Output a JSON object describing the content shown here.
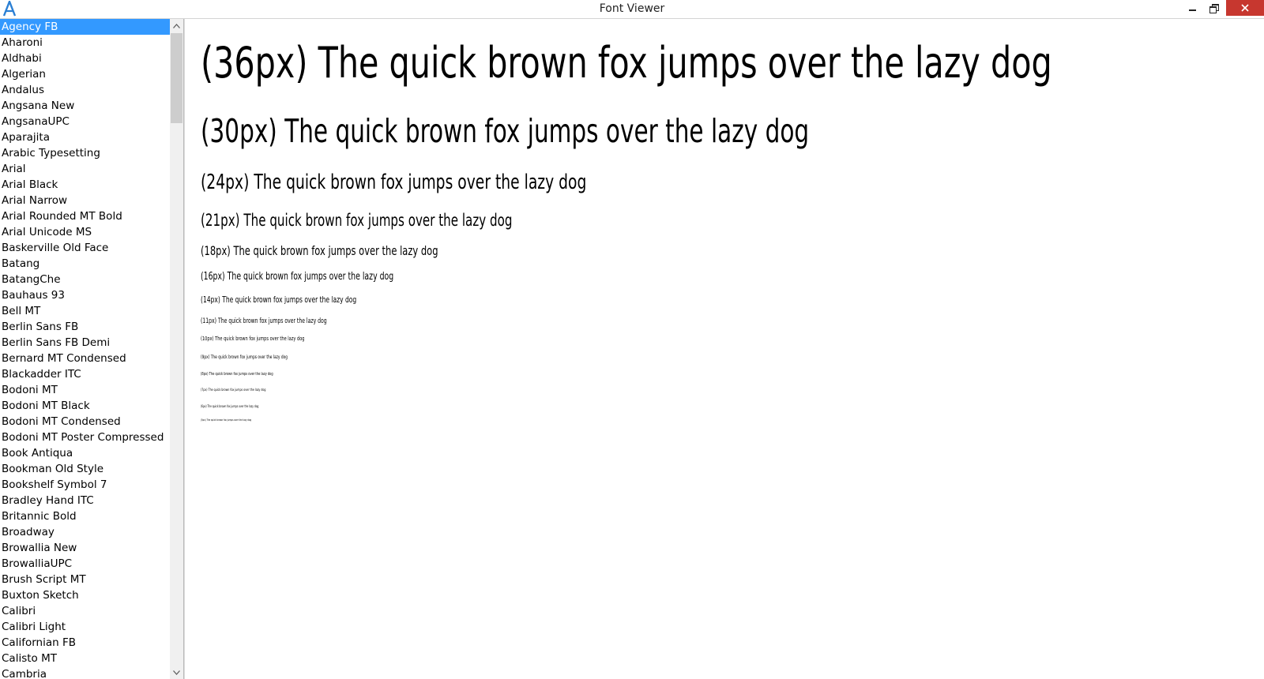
{
  "window": {
    "title": "Font Viewer",
    "logo_icon": "app-letter-a-icon"
  },
  "titlebar": {
    "minimize_icon": "minimize-icon",
    "restore_icon": "restore-icon",
    "close_icon": "close-icon",
    "close_color": "#c7372f"
  },
  "sidebar": {
    "selected_index": 0,
    "selected_color": "#3399ff",
    "fonts": [
      "Agency FB",
      "Aharoni",
      "Aldhabi",
      "Algerian",
      "Andalus",
      "Angsana New",
      "AngsanaUPC",
      "Aparajita",
      "Arabic Typesetting",
      "Arial",
      "Arial Black",
      "Arial Narrow",
      "Arial Rounded MT Bold",
      "Arial Unicode MS",
      "Baskerville Old Face",
      "Batang",
      "BatangChe",
      "Bauhaus 93",
      "Bell MT",
      "Berlin Sans FB",
      "Berlin Sans FB Demi",
      "Bernard MT Condensed",
      "Blackadder ITC",
      "Bodoni MT",
      "Bodoni MT Black",
      "Bodoni MT Condensed",
      "Bodoni MT Poster Compressed",
      "Book Antiqua",
      "Bookman Old Style",
      "Bookshelf Symbol 7",
      "Bradley Hand ITC",
      "Britannic Bold",
      "Broadway",
      "Browallia New",
      "BrowalliaUPC",
      "Brush Script MT",
      "Buxton Sketch",
      "Calibri",
      "Calibri Light",
      "Californian FB",
      "Calisto MT",
      "Cambria"
    ]
  },
  "preview": {
    "samples": [
      "(36px) The quick brown fox jumps over the lazy dog",
      "(30px) The quick brown fox jumps over the lazy dog",
      "(24px) The quick brown fox jumps over the lazy dog",
      "(21px) The quick brown fox jumps over the lazy dog",
      "(18px) The quick brown fox jumps over the lazy dog",
      "(16px) The quick brown fox jumps over the lazy dog",
      "(14px) The quick brown fox jumps over the lazy dog",
      "(11px) The quick brown fox jumps over the lazy dog",
      "(10px) The quick brown fox jumps over the lazy dog",
      "(9px) The quick brown fox jumps over the lazy dog",
      "(8px) The quick brown fox jumps over the lazy dog",
      "(7px) The quick brown fox jumps over the lazy dog",
      "(6px) The quick brown fox jumps over the lazy dog",
      "(5px) The quick brown fox jumps over the lazy dog"
    ]
  }
}
